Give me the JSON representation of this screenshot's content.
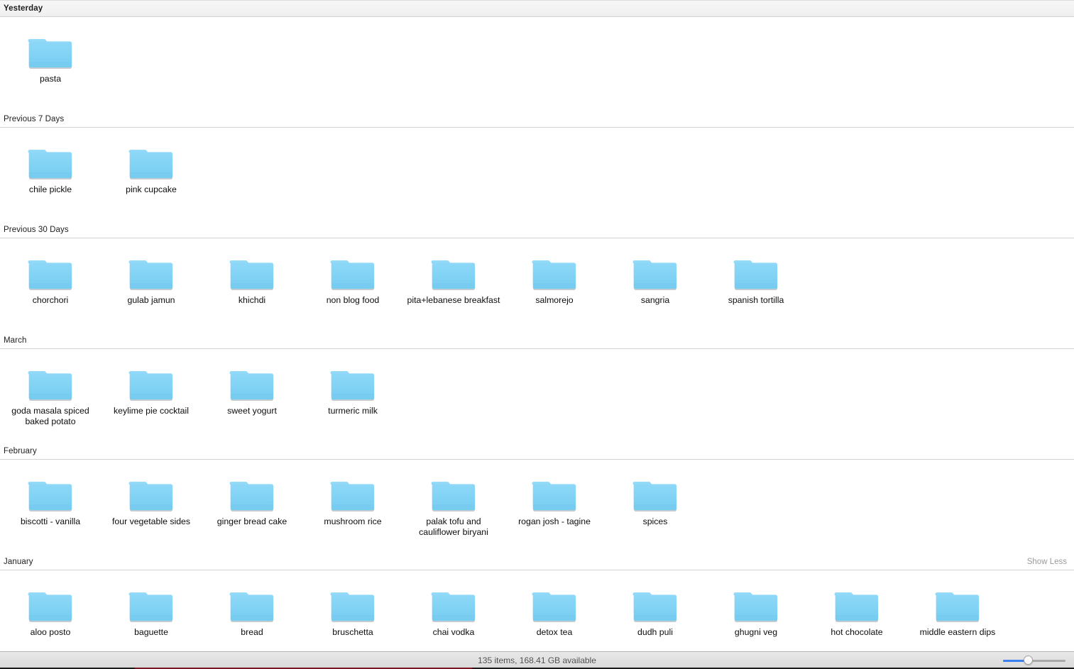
{
  "window": {
    "view_mode": "icon-view",
    "accent_color": "#3b7ff5",
    "folder_color": "#7fd4f5",
    "background_color": "#ffffff"
  },
  "status_bar": {
    "status_text": "135 items, 168.41 GB available",
    "item_count": 135,
    "space_available": "168.41 GB",
    "zoom_slider": {
      "value_percent": 38,
      "min": 0,
      "max": 100
    }
  },
  "sections": [
    {
      "label": "Yesterday",
      "sticky": true,
      "show_toggle": "",
      "items": [
        {
          "name": "pasta",
          "icon": "folder-icon"
        }
      ]
    },
    {
      "label": "Previous 7 Days",
      "sticky": false,
      "show_toggle": "",
      "items": [
        {
          "name": "chile pickle",
          "icon": "folder-icon"
        },
        {
          "name": "pink cupcake",
          "icon": "folder-icon"
        }
      ]
    },
    {
      "label": "Previous 30 Days",
      "sticky": false,
      "show_toggle": "",
      "items": [
        {
          "name": "chorchori",
          "icon": "folder-icon"
        },
        {
          "name": "gulab jamun",
          "icon": "folder-icon"
        },
        {
          "name": "khichdi",
          "icon": "folder-icon"
        },
        {
          "name": "non blog food",
          "icon": "folder-icon"
        },
        {
          "name": "pita+lebanese breakfast",
          "icon": "folder-icon"
        },
        {
          "name": "salmorejo",
          "icon": "folder-icon"
        },
        {
          "name": "sangria",
          "icon": "folder-icon"
        },
        {
          "name": "spanish tortilla",
          "icon": "folder-icon"
        }
      ]
    },
    {
      "label": "March",
      "sticky": false,
      "show_toggle": "",
      "items": [
        {
          "name": "goda masala spiced baked potato",
          "icon": "folder-icon"
        },
        {
          "name": "keylime pie cocktail",
          "icon": "folder-icon"
        },
        {
          "name": "sweet yogurt",
          "icon": "folder-icon"
        },
        {
          "name": "turmeric milk",
          "icon": "folder-icon"
        }
      ]
    },
    {
      "label": "February",
      "sticky": false,
      "show_toggle": "",
      "items": [
        {
          "name": "biscotti - vanilla",
          "icon": "folder-icon"
        },
        {
          "name": "four vegetable sides",
          "icon": "folder-icon"
        },
        {
          "name": "ginger bread cake",
          "icon": "folder-icon"
        },
        {
          "name": "mushroom rice",
          "icon": "folder-icon"
        },
        {
          "name": "palak tofu and cauliflower biryani",
          "icon": "folder-icon"
        },
        {
          "name": "rogan josh - tagine",
          "icon": "folder-icon"
        },
        {
          "name": "spices",
          "icon": "folder-icon"
        }
      ]
    },
    {
      "label": "January",
      "sticky": false,
      "show_toggle": "Show Less",
      "items": [
        {
          "name": "aloo posto",
          "icon": "folder-icon"
        },
        {
          "name": "baguette",
          "icon": "folder-icon"
        },
        {
          "name": "bread",
          "icon": "folder-icon"
        },
        {
          "name": "bruschetta",
          "icon": "folder-icon"
        },
        {
          "name": "chai vodka",
          "icon": "folder-icon"
        },
        {
          "name": "detox tea",
          "icon": "folder-icon"
        },
        {
          "name": "dudh puli",
          "icon": "folder-icon"
        },
        {
          "name": "ghugni veg",
          "icon": "folder-icon"
        },
        {
          "name": "hot chocolate",
          "icon": "folder-icon"
        },
        {
          "name": "middle eastern dips",
          "icon": "folder-icon"
        }
      ]
    }
  ]
}
